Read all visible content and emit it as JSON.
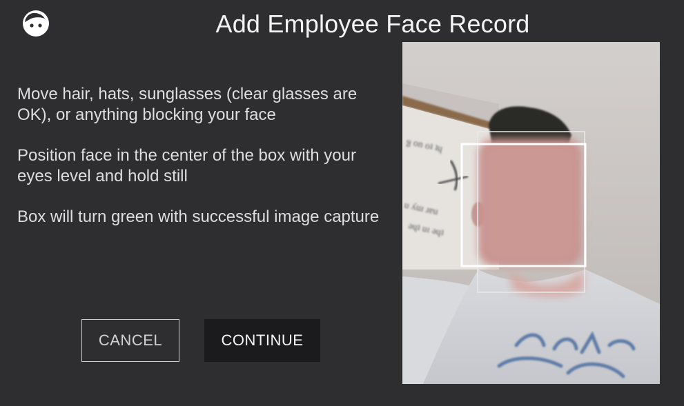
{
  "header": {
    "title": "Add Employee Face Record",
    "icon": "face-icon"
  },
  "instructions": [
    "Move hair, hats, sunglasses (clear glasses are OK), or anything blocking your face",
    "Position face in the center of the box with your eyes level and hold still",
    "Box will turn green with successful image capture"
  ],
  "actions": {
    "cancel_label": "CANCEL",
    "continue_label": "CONTINUE"
  },
  "camera": {
    "face_box_color": "#ffffff",
    "face_box_success_color": "#2ecc40"
  },
  "colors": {
    "background": "#2e2e30",
    "primary_button": "#1b1b1d",
    "text": "#e9e9ea"
  }
}
